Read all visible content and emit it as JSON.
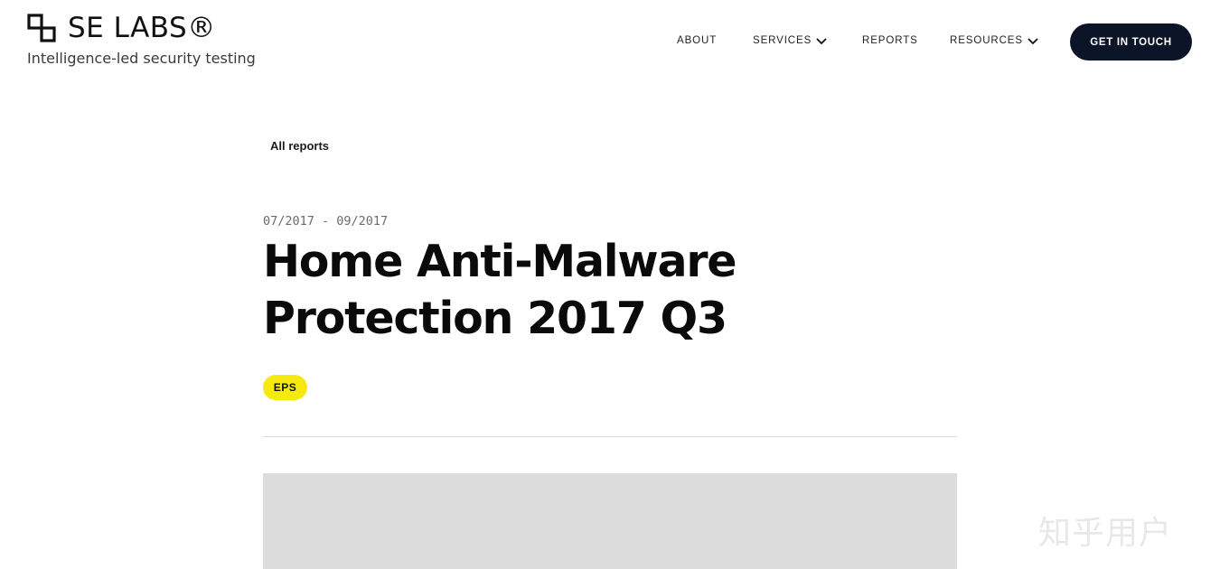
{
  "header": {
    "logo_text": "SE LABS®",
    "tagline": "Intelligence-led security testing",
    "nav": {
      "about": "ABOUT",
      "services": "SERVICES",
      "reports": "REPORTS",
      "resources": "RESOURCES"
    },
    "cta_label": "GET IN TOUCH"
  },
  "breadcrumb": {
    "all_reports": "All reports"
  },
  "report": {
    "date_range": "07/2017 - 09/2017",
    "title": "Home Anti-Malware Protection 2017 Q3",
    "tag": "EPS"
  },
  "watermark": "知乎用户",
  "colors": {
    "cta_background": "#0c1427",
    "tag_background": "#f5ea0c",
    "image_placeholder": "#dcdcdc"
  },
  "icons": {
    "logo": "se-labs-logo-icon",
    "dropdown": "chevron-down-icon"
  }
}
